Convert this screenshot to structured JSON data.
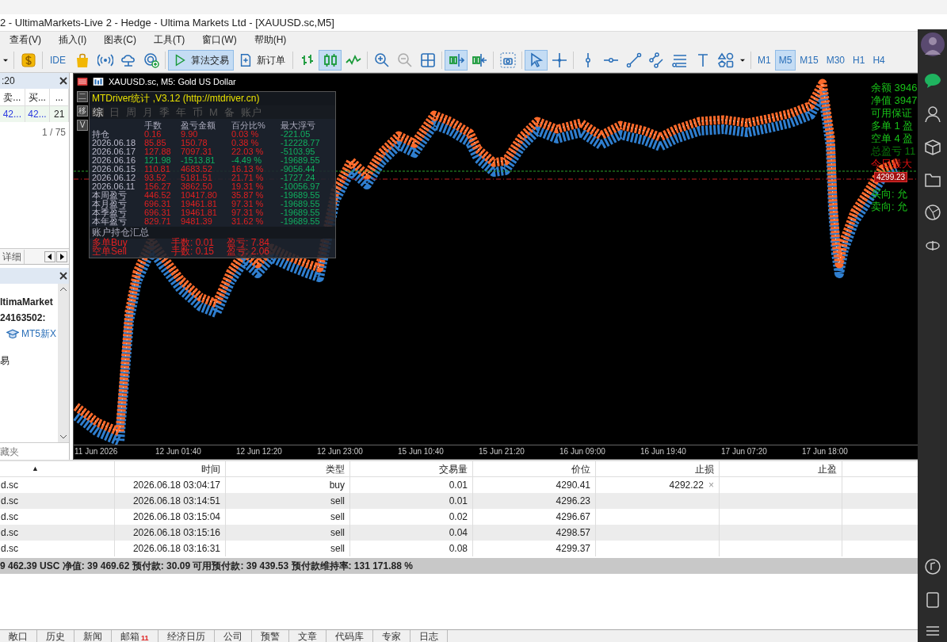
{
  "window": {
    "title": "2 - UltimaMarkets-Live 2 - Hedge - Ultima Markets Ltd - [XAUUSD.sc,M5]"
  },
  "menu": [
    "查看(V)",
    "插入(I)",
    "图表(C)",
    "工具(T)",
    "窗口(W)",
    "帮助(H)"
  ],
  "toolbar": [
    [
      {
        "kind": "caret",
        "selected": false
      }
    ],
    [
      {
        "kind": "dollar",
        "selected": false
      }
    ],
    [
      {
        "kind": "ide",
        "label": "IDE",
        "selected": false
      },
      {
        "kind": "bag",
        "selected": false
      },
      {
        "kind": "signal",
        "selected": false
      },
      {
        "kind": "cloud",
        "selected": false
      },
      {
        "kind": "globe",
        "selected": false
      }
    ],
    [
      {
        "kind": "algo",
        "label": "算法交易",
        "selected": true
      },
      {
        "kind": "neworder",
        "label": "新订单",
        "selected": false
      }
    ],
    [
      {
        "kind": "bars",
        "selected": false
      },
      {
        "kind": "candles",
        "selected": true
      },
      {
        "kind": "line",
        "selected": false
      }
    ],
    [
      {
        "kind": "zoomin",
        "selected": false
      },
      {
        "kind": "zoomout",
        "selected": false
      },
      {
        "kind": "grid",
        "selected": false
      }
    ],
    [
      {
        "kind": "autoscroll",
        "selected": true
      },
      {
        "kind": "shift",
        "selected": false
      }
    ],
    [
      {
        "kind": "screenshot",
        "selected": false
      }
    ],
    [
      {
        "kind": "cursor",
        "selected": true
      },
      {
        "kind": "crosshair",
        "selected": false
      }
    ],
    [
      {
        "kind": "vline",
        "selected": false
      },
      {
        "kind": "hline",
        "selected": false
      },
      {
        "kind": "trend",
        "selected": false
      },
      {
        "kind": "channel",
        "selected": false
      },
      {
        "kind": "fibo",
        "selected": false
      },
      {
        "kind": "text",
        "selected": false
      },
      {
        "kind": "shapes",
        "selected": false
      },
      {
        "kind": "caret",
        "selected": false
      }
    ],
    [
      {
        "kind": "tf",
        "label": "M1",
        "selected": false
      },
      {
        "kind": "tf",
        "label": "M5",
        "selected": true
      },
      {
        "kind": "tf",
        "label": "M15",
        "selected": false
      },
      {
        "kind": "tf",
        "label": "M30",
        "selected": false
      },
      {
        "kind": "tf",
        "label": "H1",
        "selected": false
      },
      {
        "kind": "tf",
        "label": "H4",
        "selected": false
      }
    ]
  ],
  "market_watch": {
    "title": ":20",
    "columns": [
      "卖...",
      "买...",
      "..."
    ],
    "row": [
      "42...",
      "42...",
      "21"
    ],
    "count": "1 / 75",
    "tabs": [
      "详细"
    ]
  },
  "navigator": {
    "lines": [
      {
        "kind": "bold",
        "text": "ltimaMarket"
      },
      {
        "kind": "bold",
        "text": "24163502:"
      },
      {
        "kind": "link",
        "text": "MT5新X"
      },
      {
        "kind": "plain",
        "text": "易"
      }
    ],
    "footer": "藏夹"
  },
  "chart": {
    "title": "XAUUSD.sc, M5:  Gold US Dollar",
    "side_buttons": [
      "二",
      "移",
      "V"
    ],
    "stats": {
      "title": "MTDriver统计 ,V3.12 (http://mtdriver.cn)",
      "tabs": [
        {
          "label": "综",
          "selected": true
        },
        {
          "label": "日",
          "selected": false
        },
        {
          "label": "周",
          "selected": false
        },
        {
          "label": "月",
          "selected": false
        },
        {
          "label": "季",
          "selected": false
        },
        {
          "label": "年",
          "selected": false
        },
        {
          "label": "币",
          "selected": false
        },
        {
          "label": "M",
          "selected": false
        },
        {
          "label": "备",
          "selected": false
        },
        {
          "label": "账户",
          "selected": false
        }
      ],
      "columns": [
        "手数",
        "盈亏金额",
        "百分比%",
        "最大浮亏"
      ],
      "rows": [
        {
          "label": "持仓",
          "color": "#e02020",
          "cells": [
            "0.16",
            "9.90",
            "0.03 %",
            "-221.05"
          ]
        },
        {
          "label": "2026.06.18",
          "color": "#e02020",
          "cells": [
            "85.85",
            "150.78",
            "0.38 %",
            "-12228.77"
          ]
        },
        {
          "label": "2026.06.17",
          "color": "#e02020",
          "cells": [
            "127.88",
            "7097.31",
            "22.03 %",
            "-5103.95"
          ]
        },
        {
          "label": "2026.06.16",
          "color": "#10b060",
          "cells": [
            "121.98",
            "-1513.81",
            "-4.49 %",
            "-19689.55"
          ]
        },
        {
          "label": "2026.06.15",
          "color": "#e02020",
          "cells": [
            "110.81",
            "4683.52",
            "16.13 %",
            "-9056.44"
          ]
        },
        {
          "label": "2026.06.12",
          "color": "#e02020",
          "cells": [
            "93.52",
            "5181.51",
            "21.71 %",
            "-1727.24"
          ]
        },
        {
          "label": "2026.06.11",
          "color": "#e02020",
          "cells": [
            "156.27",
            "3862.50",
            "19.31 %",
            "-10056.97"
          ]
        },
        {
          "label": "本周盈亏",
          "color": "#e02020",
          "cells": [
            "446.52",
            "10417.80",
            "35.87 %",
            "-19689.55"
          ]
        },
        {
          "label": "本月盈亏",
          "color": "#e02020",
          "cells": [
            "696.31",
            "19461.81",
            "97.31 %",
            "-19689.55"
          ]
        },
        {
          "label": "本季盈亏",
          "color": "#e02020",
          "cells": [
            "696.31",
            "19461.81",
            "97.31 %",
            "-19689.55"
          ]
        },
        {
          "label": "本年盈亏",
          "color": "#e02020",
          "cells": [
            "829.71",
            "9481.39",
            "31.62 %",
            "-19689.55"
          ]
        }
      ],
      "summary_title": "账户持仓汇总",
      "summary": [
        [
          "多单Buy",
          "手数: 0.01",
          "盈亏: 7.84"
        ],
        [
          "空单Sell",
          "手数: 0.15",
          "盈亏: 2.06"
        ]
      ]
    },
    "info": [
      {
        "kind": "green",
        "text": "余额 3946"
      },
      {
        "kind": "green",
        "text": "净值 3947"
      },
      {
        "kind": "green",
        "text": "可用保证"
      },
      {
        "kind": "green",
        "text": "多单 1  盈"
      },
      {
        "kind": "green",
        "text": "空单 4  盈"
      },
      {
        "kind": "dim",
        "text": "总盈亏 11"
      },
      {
        "kind": "red",
        "text": "今日最大"
      },
      {
        "kind": "spaced",
        "text": "买向: 允"
      },
      {
        "kind": "green",
        "text": "卖向: 允"
      }
    ],
    "price_tag": "4299.23",
    "time_axis": [
      "11 Jun 2026",
      "12 Jun 01:40",
      "12 Jun 12:20",
      "12 Jun 23:00",
      "15 Jun 10:40",
      "15 Jun 21:20",
      "16 Jun 09:00",
      "16 Jun 19:40",
      "17 Jun 07:20",
      "17 Jun 18:00"
    ]
  },
  "orders": {
    "columns": [
      "▲",
      "时间",
      "类型",
      "交易量",
      "价位",
      "止损",
      "止盈"
    ],
    "rows": [
      [
        "d.sc",
        "2026.06.18 03:04:17",
        "buy",
        "0.01",
        "4290.41",
        "4292.22"
      ],
      [
        "d.sc",
        "2026.06.18 03:14:51",
        "sell",
        "0.01",
        "4296.23",
        ""
      ],
      [
        "d.sc",
        "2026.06.18 03:15:04",
        "sell",
        "0.02",
        "4296.67",
        ""
      ],
      [
        "d.sc",
        "2026.06.18 03:15:16",
        "sell",
        "0.04",
        "4298.57",
        ""
      ],
      [
        "d.sc",
        "2026.06.18 03:16:31",
        "sell",
        "0.08",
        "4299.37",
        ""
      ]
    ],
    "remove_mark": "×",
    "summary": "9 462.39 USC  净值: 39 469.62  预付款: 30.09  可用预付款: 39 439.53  预付款维持率: 131 171.88 %"
  },
  "bottom_tabs": [
    {
      "label": "敞口"
    },
    {
      "label": "历史"
    },
    {
      "label": "新闻"
    },
    {
      "label": "邮箱",
      "badge": "11"
    },
    {
      "label": "经济日历"
    },
    {
      "label": "公司"
    },
    {
      "label": "预警"
    },
    {
      "label": "文章"
    },
    {
      "label": "代码库"
    },
    {
      "label": "专家"
    },
    {
      "label": "日志"
    }
  ]
}
